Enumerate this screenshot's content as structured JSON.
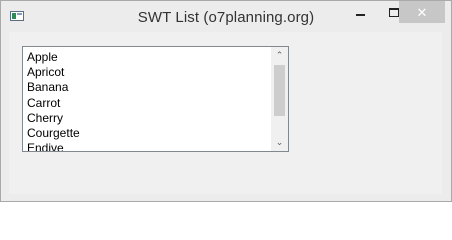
{
  "window": {
    "title": "SWT List (o7planning.org)",
    "icon": "app-window-icon",
    "controls": {
      "minimize": "minimize-icon",
      "maximize": "maximize-icon",
      "close": "close-icon",
      "close_glyph": "✕"
    }
  },
  "list": {
    "items": [
      "Apple",
      "Apricot",
      "Banana",
      "Carrot",
      "Cherry",
      "Courgette",
      "Endive"
    ],
    "scrollbar": {
      "up_glyph": "⌃",
      "down_glyph": "⌄",
      "position": 0.0
    }
  },
  "colors": {
    "titlebar": "#ececec",
    "client": "#f0f0f0",
    "close_button": "#c7c7c7",
    "list_border": "#828790"
  }
}
